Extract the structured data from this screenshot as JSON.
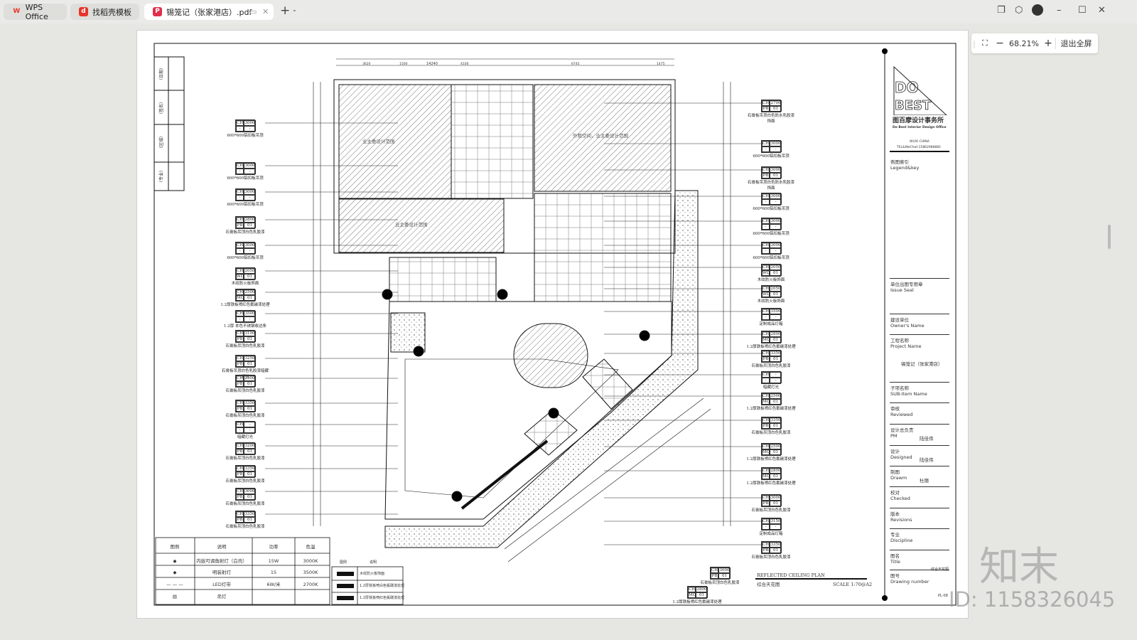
{
  "tabs": [
    {
      "label": "WPS Office",
      "icon": "wps-logo-icon",
      "color": "#e8352b"
    },
    {
      "label": "找稻壳模板",
      "icon": "docer-icon",
      "color": "#e8352b"
    },
    {
      "label": "锡笼记（张家港店）.pdf",
      "icon": "pdf-icon",
      "color": "#e0304a",
      "active": true
    }
  ],
  "zoom": {
    "value": "68.21%",
    "exit_label": "退出全屏"
  },
  "drawing": {
    "title_en": "REFLECTED CEILING PLAN",
    "title_cn": "综合天花图",
    "scale": "SCALE  1:70@A2",
    "dim_top_total": "14240",
    "dims_top": [
      "3620",
      "1500",
      "4100",
      "6745",
      "1475"
    ],
    "left_strip": [
      "（日期）",
      "（签名）",
      "（区域）",
      "（专业）"
    ],
    "room_labels": [
      "业主委设计范围",
      "外租空间，业主委设计范围",
      "业主委设计范围"
    ],
    "left_tags": [
      {
        "ch": "3000",
        "code": "-",
        "no": "-",
        "desc": "600*600铝扣板吊顶"
      },
      {
        "ch": "3000",
        "code": "-",
        "no": "-",
        "desc": "600*600铝扣板吊顶"
      },
      {
        "ch": "3000",
        "code": "-",
        "no": "-",
        "desc": "600*600铝扣板吊顶"
      },
      {
        "ch": "2800",
        "code": "PB",
        "no": "01",
        "desc": "石膏板吊顶白色乳胶漆"
      },
      {
        "ch": "3000",
        "code": "-",
        "no": "-",
        "desc": "600*600铝扣板吊顶"
      },
      {
        "ch": "2050",
        "code": "WD",
        "no": "01",
        "desc": "木纹防火板饰面"
      },
      {
        "ch": "2500",
        "code": "MC",
        "no": "01",
        "desc": "1.2厚铁板喷红色氟碳漆处理"
      },
      {
        "ch": "3500",
        "code": "-",
        "no": "-",
        "desc": "1.2厚 本色不锈钢收边条"
      },
      {
        "ch": "3100",
        "code": "PB",
        "no": "01",
        "desc": "石膏板吊顶白色乳胶漆"
      },
      {
        "ch": "3250",
        "code": "PB",
        "no": "01",
        "desc": "石膏板吊顶白色乳胶漆暗藏灯光"
      },
      {
        "ch": "2500",
        "code": "PB",
        "no": "01",
        "desc": "石膏板吊顶白色乳胶漆"
      },
      {
        "ch": "3350",
        "code": "PB",
        "no": "01",
        "desc": "石膏板吊顶白色乳胶漆"
      },
      {
        "ch": "-",
        "code": "-",
        "no": "-",
        "desc": "暗藏灯光"
      },
      {
        "ch": "3200",
        "code": "PB",
        "no": "01",
        "desc": "石膏板吊顶白色乳胶漆"
      },
      {
        "ch": "3350",
        "code": "PB",
        "no": "01",
        "desc": "石膏板吊顶白色乳胶漆"
      },
      {
        "ch": "3000",
        "code": "PB",
        "no": "01",
        "desc": "石膏板吊顶白色乳胶漆"
      },
      {
        "ch": "3350",
        "code": "PB",
        "no": "01",
        "desc": "石膏板吊顶白色乳胶漆"
      }
    ],
    "right_tags": [
      {
        "ch": "2700",
        "code": "PB",
        "no": "01",
        "desc": "石膏板吊顶白色防水乳胶漆饰面"
      },
      {
        "ch": "3000",
        "code": "-",
        "no": "-",
        "desc": "600*600铝扣板吊顶"
      },
      {
        "ch": "3000",
        "code": "PB",
        "no": "01",
        "desc": "石膏板吊顶白色防水乳胶漆饰面"
      },
      {
        "ch": "3000",
        "code": "-",
        "no": "-",
        "desc": "600*600铝扣板吊顶"
      },
      {
        "ch": "3000",
        "code": "-",
        "no": "-",
        "desc": "600*600铝扣板吊顶"
      },
      {
        "ch": "3000",
        "code": "-",
        "no": "-",
        "desc": "600*600铝扣板吊顶"
      },
      {
        "ch": "2050",
        "code": "WD",
        "no": "01",
        "desc": "木纹防火板饰面"
      },
      {
        "ch": "2050",
        "code": "WD",
        "no": "01",
        "desc": "木纹防火板饰面"
      },
      {
        "ch": "3500",
        "code": "-",
        "no": "-",
        "desc": "定制成品灯箱"
      },
      {
        "ch": "2800",
        "code": "MC",
        "no": "01",
        "desc": "1.2厚铁板喷红色氟碳漆处理"
      },
      {
        "ch": "3350",
        "code": "PB",
        "no": "01",
        "desc": "石膏板吊顶白色乳胶漆"
      },
      {
        "ch": "-",
        "code": "-",
        "no": "-",
        "desc": "暗藏灯光"
      },
      {
        "ch": "2500",
        "code": "MC",
        "no": "01",
        "desc": "1.2厚铁板喷红色氟碳漆处理"
      },
      {
        "ch": "3350",
        "code": "PB",
        "no": "01",
        "desc": "石膏板吊顶白色乳胶漆"
      },
      {
        "ch": "2500",
        "code": "MC",
        "no": "01",
        "desc": "1.2厚铁板喷红色氟碳漆处理"
      },
      {
        "ch": "2800",
        "code": "MC",
        "no": "01",
        "desc": "1.2厚铁板喷红色氟碳漆处理"
      },
      {
        "ch": "3000",
        "code": "PB",
        "no": "01",
        "desc": "石膏板吊顶白色乳胶漆"
      },
      {
        "ch": "3150",
        "code": "-",
        "no": "-",
        "desc": "定制成品灯箱"
      },
      {
        "ch": "3350",
        "code": "PB",
        "no": "01",
        "desc": "石膏板吊顶白色乳胶漆"
      }
    ],
    "bottom_tags": [
      {
        "ch": "3000",
        "code": "PB",
        "no": "01",
        "desc": "石膏板吊顶白色乳胶漆"
      },
      {
        "ch": "2800",
        "code": "MC",
        "no": "01",
        "desc": "1.2厚铁板喷红色氟碳漆处理"
      }
    ],
    "light_legend": {
      "headers": [
        "图例",
        "说明",
        "功率",
        "色温"
      ],
      "rows": [
        [
          "◆",
          "内嵌可调角射灯（白壳）",
          "15W",
          "3000K"
        ],
        [
          "◆",
          "明装射灯",
          "15",
          "3500K"
        ],
        [
          "— — —",
          "LED灯带",
          "6W/米",
          "2700K"
        ],
        [
          "▤",
          "吊灯",
          "",
          ""
        ]
      ]
    },
    "material_legend": {
      "headers": [
        "图例",
        "说明"
      ],
      "rows": [
        "木纹防火板饰面",
        "1.2厚铁板喷白色氟碳漆处理",
        "1.2厚铁板喷红色氟碳漆处理"
      ]
    }
  },
  "title_block": {
    "company_cn": "图百摩设计事务所",
    "company_en": "Do Best Interior Design Office",
    "logo_text": "DO BEST",
    "city": "WUXI CHINA",
    "tel": "TEL&WeChat:15862988881",
    "fields": [
      {
        "cn": "例图索引",
        "en": "Legend&key",
        "value": ""
      },
      {
        "cn": "单位出图专用章",
        "en": "Issue Seal",
        "value": ""
      },
      {
        "cn": "建设单位",
        "en": "Owner's Name",
        "value": ""
      },
      {
        "cn": "工程名称",
        "en": "Project Name",
        "value": "锡笼记（张家港店）"
      },
      {
        "cn": "子项名称",
        "en": "SUB-Item Name",
        "value": ""
      },
      {
        "cn": "审核",
        "en": "Reviewed",
        "value": ""
      },
      {
        "cn": "设计总负责",
        "en": "PM",
        "value": "陆佳伟"
      },
      {
        "cn": "设计",
        "en": "Designed",
        "value": "陆佳伟"
      },
      {
        "cn": "制图",
        "en": "Drawm",
        "value": "杜丽"
      },
      {
        "cn": "校对",
        "en": "Checked",
        "value": ""
      },
      {
        "cn": "版本",
        "en": "Revisions",
        "value": ""
      },
      {
        "cn": "专业",
        "en": "Discipline",
        "value": ""
      },
      {
        "cn": "图名",
        "en": "Title",
        "value": "综合天花图"
      },
      {
        "cn": "图号",
        "en": "Drawing number",
        "value": "PL-08"
      }
    ]
  },
  "watermark": {
    "brand": "知末",
    "id": "ID: 1158326045"
  }
}
